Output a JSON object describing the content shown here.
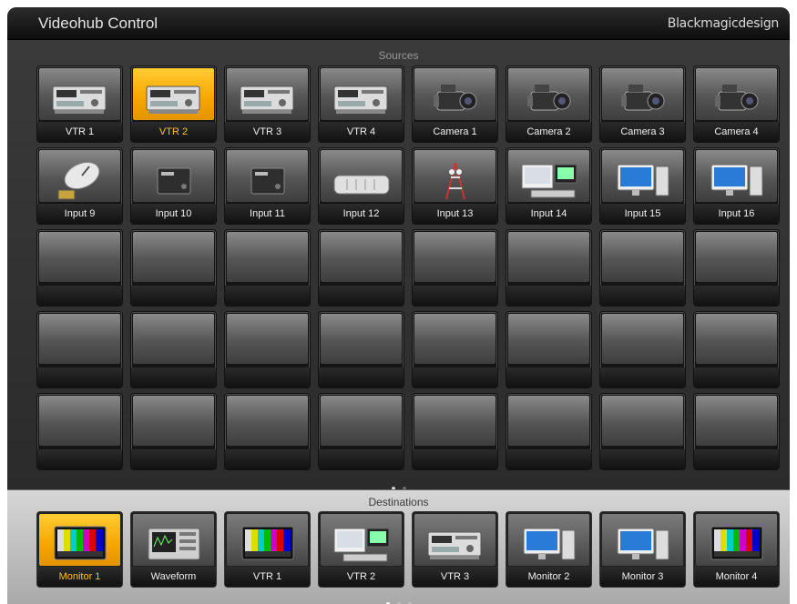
{
  "header": {
    "title": "Videohub Control",
    "brand": "Blackmagicdesign"
  },
  "sources": {
    "label": "Sources",
    "selected_index": 1,
    "items": [
      {
        "label": "VTR 1",
        "icon": "vtr-deck-icon"
      },
      {
        "label": "VTR 2",
        "icon": "vtr-deck-icon"
      },
      {
        "label": "VTR 3",
        "icon": "vtr-deck-icon"
      },
      {
        "label": "VTR 4",
        "icon": "vtr-deck-icon"
      },
      {
        "label": "Camera 1",
        "icon": "camera-icon"
      },
      {
        "label": "Camera 2",
        "icon": "camera-icon"
      },
      {
        "label": "Camera 3",
        "icon": "camera-icon"
      },
      {
        "label": "Camera 4",
        "icon": "camera-icon"
      },
      {
        "label": "Input 9",
        "icon": "satellite-dish-icon"
      },
      {
        "label": "Input 10",
        "icon": "converter-box-icon"
      },
      {
        "label": "Input 11",
        "icon": "converter-box-icon"
      },
      {
        "label": "Input 12",
        "icon": "rack-unit-icon"
      },
      {
        "label": "Input 13",
        "icon": "broadcast-tower-icon"
      },
      {
        "label": "Input 14",
        "icon": "workstation-monitor-icon"
      },
      {
        "label": "Input 15",
        "icon": "desktop-computer-icon"
      },
      {
        "label": "Input 16",
        "icon": "desktop-computer-icon"
      }
    ],
    "empty_count": 24
  },
  "pager": {
    "pages": 2,
    "current": 0
  },
  "destinations": {
    "label": "Destinations",
    "selected_index": 0,
    "items": [
      {
        "label": "Monitor 1",
        "icon": "color-bars-monitor-icon"
      },
      {
        "label": "Waveform",
        "icon": "waveform-monitor-icon"
      },
      {
        "label": "VTR 1",
        "icon": "color-bars-monitor-icon"
      },
      {
        "label": "VTR 2",
        "icon": "workstation-monitor-icon"
      },
      {
        "label": "VTR 3",
        "icon": "vtr-deck-icon"
      },
      {
        "label": "Monitor 2",
        "icon": "desktop-computer-icon"
      },
      {
        "label": "Monitor 3",
        "icon": "desktop-computer-icon"
      },
      {
        "label": "Monitor 4",
        "icon": "color-bars-monitor-icon"
      }
    ]
  },
  "dest_pager": {
    "pages": 3,
    "current": 0
  }
}
